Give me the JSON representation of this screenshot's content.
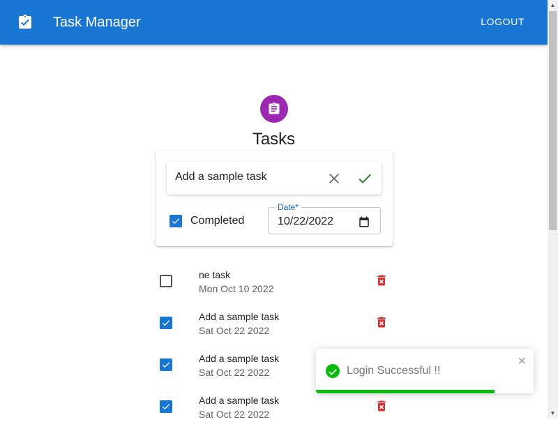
{
  "appbar": {
    "title": "Task Manager",
    "logout_label": "LOGOUT",
    "logo_icon": "clipboard-check-icon",
    "color": "#1976d2"
  },
  "page": {
    "avatar_icon": "assignment-icon",
    "avatar_color": "#9c27b0",
    "title": "Tasks"
  },
  "form": {
    "task_value": "Add a sample task",
    "completed_label": "Completed",
    "completed": true,
    "date_label": "Date",
    "date_required_mark": "*",
    "date_value": "10/22/2022"
  },
  "tasks": [
    {
      "name": "ne task",
      "date": "Mon Oct 10 2022",
      "completed": false
    },
    {
      "name": "Add a sample task",
      "date": "Sat Oct 22 2022",
      "completed": true
    },
    {
      "name": "Add a sample task",
      "date": "Sat Oct 22 2022",
      "completed": true
    },
    {
      "name": "Add a sample task",
      "date": "Sat Oct 22 2022",
      "completed": true
    }
  ],
  "toast": {
    "message": "Login Successful !!",
    "close_symbol": "✕",
    "progress": 0.82,
    "color": "#07bc0c"
  },
  "colors": {
    "delete": "#d32f2f",
    "confirm": "#2e7d32",
    "checkbox": "#1976d2"
  }
}
